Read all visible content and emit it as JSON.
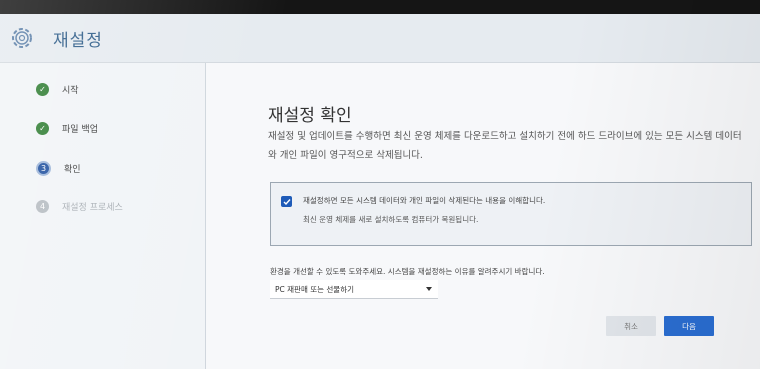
{
  "header": {
    "title": "재설정",
    "icon": "gear-icon"
  },
  "steps": [
    {
      "label": "시작",
      "state": "done",
      "marker": ""
    },
    {
      "label": "파일 백업",
      "state": "done",
      "marker": ""
    },
    {
      "label": "확인",
      "state": "current",
      "marker": "3"
    },
    {
      "label": "재설정 프로세스",
      "state": "pending",
      "marker": "4"
    }
  ],
  "main": {
    "heading": "재설정 확인",
    "description": "재설정 및 업데이트를 수행하면 최신 운영 체제를 다운로드하고 설치하기 전에 하드 드라이브에 있는 모든 시스템 데이터와 개인 파일이 영구적으로 삭제됩니다.",
    "confirm_text": "재설정하면 모든 시스템 데이터와 개인 파일이 삭제된다는 내용을 이해합니다.",
    "confirm_sub": "최신 운영 체제를 새로 설치하도록 컴퓨터가 복원됩니다.",
    "confirm_checked": true,
    "feedback_label": "환경을 개선할 수 있도록 도와주세요. 시스템을 재설정하는 이유를 알려주시기 바랍니다.",
    "select_value": "PC 재판매 또는 선물하기"
  },
  "buttons": {
    "cancel": "취소",
    "next": "다음"
  },
  "colors": {
    "accent": "#2a6dd1",
    "done": "#2e7d32",
    "title": "#2d5c88"
  }
}
